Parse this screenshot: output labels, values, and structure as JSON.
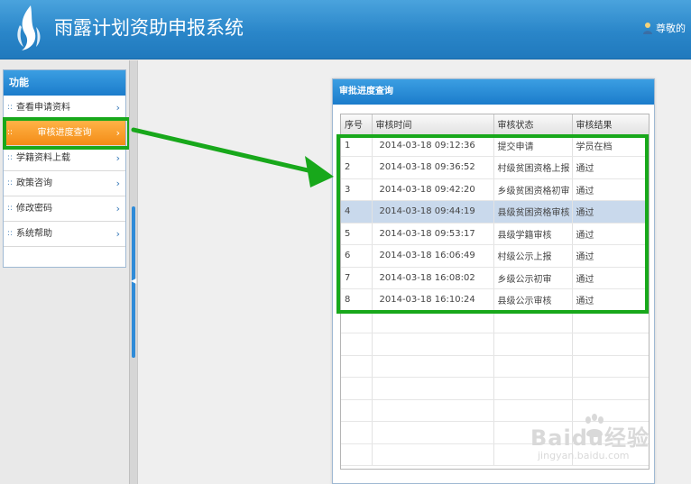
{
  "app": {
    "title": "雨露计划资助申报系统",
    "user_label": "尊敬的"
  },
  "sidebar": {
    "header": "功能",
    "items": [
      {
        "label": "查看申请资料",
        "active": false
      },
      {
        "label": "审核进度查询",
        "active": true
      },
      {
        "label": "学籍资料上载",
        "active": false
      },
      {
        "label": "政策咨询",
        "active": false
      },
      {
        "label": "修改密码",
        "active": false
      },
      {
        "label": "系统帮助",
        "active": false
      }
    ],
    "bullet_glyph": "::",
    "chevron_glyph": "›"
  },
  "dialog": {
    "title": "审批进度查询",
    "columns": [
      "序号",
      "审核时间",
      "审核状态",
      "审核结果"
    ],
    "rows": [
      {
        "no": "1",
        "time": "2014-03-18 09:12:36",
        "status": "提交申请",
        "result": "学员在档"
      },
      {
        "no": "2",
        "time": "2014-03-18 09:36:52",
        "status": "村级贫困资格上报",
        "result": "通过"
      },
      {
        "no": "3",
        "time": "2014-03-18 09:42:20",
        "status": "乡级贫困资格初审",
        "result": "通过"
      },
      {
        "no": "4",
        "time": "2014-03-18 09:44:19",
        "status": "县级贫困资格审核",
        "result": "通过"
      },
      {
        "no": "5",
        "time": "2014-03-18 09:53:17",
        "status": "县级学籍审核",
        "result": "通过"
      },
      {
        "no": "6",
        "time": "2014-03-18 16:06:49",
        "status": "村级公示上报",
        "result": "通过"
      },
      {
        "no": "7",
        "time": "2014-03-18 16:08:02",
        "status": "乡级公示初审",
        "result": "通过"
      },
      {
        "no": "8",
        "time": "2014-03-18 16:10:24",
        "status": "县级公示审核",
        "result": "通过"
      }
    ],
    "selected_row": 3
  },
  "watermark": {
    "main": "Baidu经验",
    "sub": "jingyan.baidu.com"
  },
  "colors": {
    "header": "#2a86c9",
    "active_item": "#f38b16",
    "highlight": "#18a81b",
    "selected_row": "#c9d9ec"
  }
}
